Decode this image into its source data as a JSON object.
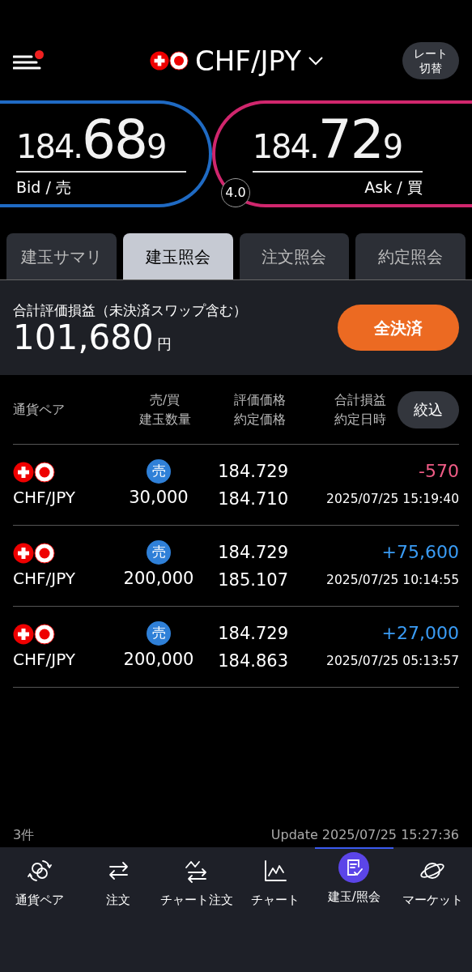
{
  "header": {
    "menu_notification": true,
    "pair": "CHF/JPY",
    "rate_switch": [
      "レート",
      "切替"
    ]
  },
  "quotes": {
    "bid": {
      "head": "184.",
      "big": "68",
      "tail": "9",
      "label": "Bid / 売"
    },
    "ask": {
      "head": "184.",
      "big": "72",
      "tail": "9",
      "label": "Ask / 買"
    },
    "spread": "4.0"
  },
  "tabs": [
    {
      "label": "建玉サマリ",
      "selected": false
    },
    {
      "label": "建玉照会",
      "selected": true
    },
    {
      "label": "注文照会",
      "selected": false
    },
    {
      "label": "約定照会",
      "selected": false
    }
  ],
  "summary": {
    "label": "合計評価損益（未決済スワップ含む）",
    "amount": "101,680",
    "unit": "円",
    "button": "全決済"
  },
  "table": {
    "columns": [
      [
        "通貨ペア"
      ],
      [
        "売/買",
        "建玉数量"
      ],
      [
        "評価価格",
        "約定価格"
      ],
      [
        "合計損益",
        "約定日時"
      ]
    ],
    "filter_button": "絞込",
    "rows": [
      {
        "pair": "CHF/JPY",
        "side": "売",
        "quantity": "30,000",
        "valuation": "184.729",
        "contract": "184.710",
        "pl": "-570",
        "color": "#f05c86",
        "datetime": "2025/07/25 15:19:40"
      },
      {
        "pair": "CHF/JPY",
        "side": "売",
        "quantity": "200,000",
        "valuation": "184.729",
        "contract": "185.107",
        "pl": "+75,600",
        "color": "#3a9cf5",
        "datetime": "2025/07/25 10:14:55"
      },
      {
        "pair": "CHF/JPY",
        "side": "売",
        "quantity": "200,000",
        "valuation": "184.729",
        "contract": "184.863",
        "pl": "+27,000",
        "color": "#3a9cf5",
        "datetime": "2025/07/25 05:13:57"
      }
    ]
  },
  "footer": {
    "count": "3件",
    "update": "Update 2025/07/25 15:27:36"
  },
  "nav": [
    {
      "label": "通貨ペア",
      "kind": "pairs",
      "selected": false
    },
    {
      "label": "注文",
      "kind": "order",
      "selected": false
    },
    {
      "label": "チャート注文",
      "kind": "chart-order",
      "selected": false
    },
    {
      "label": "チャート",
      "kind": "chart",
      "selected": false
    },
    {
      "label": "建玉/照会",
      "kind": "positions",
      "selected": true
    },
    {
      "label": "マーケット",
      "kind": "market",
      "selected": false
    }
  ]
}
